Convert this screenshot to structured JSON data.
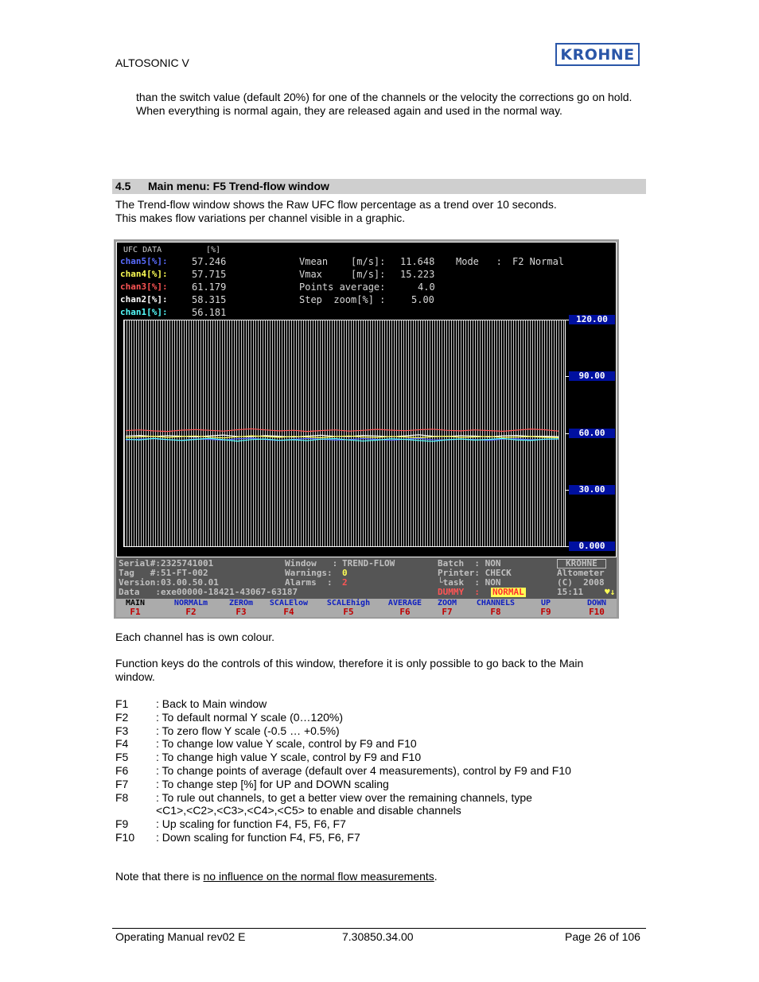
{
  "header": {
    "title": "ALTOSONIC V",
    "logo": "KROHNE"
  },
  "intro_text": "than the switch value (default 20%) for one of the channels or the velocity the corrections go on hold. When everything is normal again, they are released again and used in the normal way.",
  "section": {
    "number": "4.5",
    "title": "Main menu: F5 Trend-flow window"
  },
  "description": {
    "line1": "The Trend-flow window shows the Raw UFC flow percentage as a trend over 10 seconds.",
    "line2": "This makes flow variations per channel visible in a graphic."
  },
  "screen": {
    "ufc_header": "UFC DATA",
    "ufc_unit": "[%]",
    "channels": [
      {
        "label": "chan5[%]:",
        "value": "57.246",
        "color": "#5a6cff"
      },
      {
        "label": "chan4[%]:",
        "value": "57.715",
        "color": "#ffff55"
      },
      {
        "label": "chan3[%]:",
        "value": "61.179",
        "color": "#ff5555"
      },
      {
        "label": "chan2[%]:",
        "value": "58.315",
        "color": "#ffffff"
      },
      {
        "label": "chan1[%]:",
        "value": "56.181",
        "color": "#55ffff"
      }
    ],
    "info": {
      "vmean_label": "Vmean    [m/s]:",
      "vmean_value": "11.648",
      "vmax_label": "Vmax     [m/s]:",
      "vmax_value": "15.223",
      "points_label": "Points average:",
      "points_value": "4.0",
      "step_label": "Step  zoom[%] :",
      "step_value": "5.00",
      "mode_label": "Mode   :",
      "mode_value": "F2 Normal"
    },
    "y_ticks": [
      "120.00",
      "90.00",
      "60.00",
      "30.00",
      "0.000"
    ],
    "status": {
      "serial": "Serial#:2325741001",
      "tag": "Tag   #:51-FT-002",
      "version": "Version:03.00.50.01",
      "data": "Data   :exe00000-18421-43067-63187",
      "window_label": "Window   :",
      "window_value": "TREND-FLOW",
      "warnings_label": "Warnings:",
      "warnings_value": "0",
      "alarms_label": "Alarms  :",
      "alarms_value": "2",
      "batch": "Batch  : NON",
      "printer": "Printer: CHECK",
      "task": "└task  : NON",
      "dummy_label": "DUMMY  :",
      "dummy_value": "NORMAL",
      "brand": "KROHNE",
      "product": "Altometer",
      "copyright": "(C)  2008",
      "time": "15:11",
      "status_icons": "♥↓"
    },
    "function_keys": [
      {
        "label": "MAIN",
        "key": "F1"
      },
      {
        "label": "NORMALm",
        "key": "F2"
      },
      {
        "label": "ZEROm",
        "key": "F3"
      },
      {
        "label": "SCALElow",
        "key": "F4"
      },
      {
        "label": "SCALEhigh",
        "key": "F5"
      },
      {
        "label": "AVERAGE",
        "key": "F6"
      },
      {
        "label": "ZOOM",
        "key": "F7"
      },
      {
        "label": "CHANNELS",
        "key": "F8"
      },
      {
        "label": "UP",
        "key": "F9"
      },
      {
        "label": "DOWN",
        "key": "F10"
      }
    ]
  },
  "chart_data": {
    "type": "line",
    "title": "Trend-flow",
    "xlabel": "",
    "ylabel": "[%]",
    "ylim": [
      0,
      120
    ],
    "yticks": [
      0,
      30,
      60,
      90,
      120
    ],
    "grid": false,
    "series": [
      {
        "name": "chan3",
        "color": "#ff5555",
        "values": [
          61.5,
          61.8,
          61.3,
          61.0,
          61.7,
          62.0,
          61.6,
          61.2,
          61.9,
          62.4,
          61.8,
          61.3,
          61.6,
          61.0,
          61.5,
          61.8,
          61.2,
          61.6,
          62.1,
          61.7,
          61.4,
          61.9,
          62.2,
          61.6,
          61.3,
          61.8,
          61.5,
          61.1,
          61.7,
          62.3,
          61.9,
          61.2
        ]
      },
      {
        "name": "chan2",
        "color": "#ffffff",
        "values": [
          58.6,
          58.9,
          58.3,
          58.8,
          58.5,
          58.1,
          58.7,
          59.1,
          58.4,
          58.2,
          58.8,
          58.5,
          58.0,
          58.6,
          59.0,
          58.4,
          58.3,
          58.9,
          58.6,
          58.2,
          58.7,
          59.2,
          58.5,
          58.3,
          58.8,
          58.6,
          58.1,
          58.7,
          58.9,
          58.4,
          58.5,
          58.3
        ]
      },
      {
        "name": "chan4",
        "color": "#ffff55",
        "values": [
          57.8,
          58.2,
          58.5,
          57.9,
          58.3,
          58.6,
          58.0,
          57.6,
          58.2,
          58.7,
          58.3,
          57.9,
          58.4,
          58.1,
          57.7,
          58.3,
          58.6,
          58.0,
          57.8,
          58.4,
          58.1,
          57.7,
          58.2,
          58.5,
          57.9,
          58.1,
          58.4,
          57.8,
          58.0,
          58.3,
          57.9,
          57.7
        ]
      },
      {
        "name": "chan5",
        "color": "#5a6cff",
        "values": [
          56.5,
          56.9,
          57.2,
          56.6,
          56.3,
          57.0,
          56.8,
          56.4,
          57.1,
          57.4,
          56.7,
          56.2,
          56.8,
          57.3,
          56.9,
          56.4,
          56.7,
          57.2,
          56.8,
          56.3,
          56.9,
          57.3,
          56.6,
          56.5,
          57.0,
          56.7,
          56.2,
          56.9,
          57.1,
          56.6,
          56.8,
          57.0
        ]
      },
      {
        "name": "chan1",
        "color": "#55ffff",
        "values": [
          56.9,
          56.5,
          57.3,
          56.7,
          56.2,
          56.8,
          57.4,
          56.6,
          55.8,
          56.7,
          57.0,
          56.3,
          56.6,
          56.1,
          56.9,
          57.2,
          56.5,
          55.9,
          56.4,
          57.1,
          56.8,
          56.2,
          55.7,
          56.6,
          57.0,
          56.4,
          56.8,
          57.3,
          56.5,
          56.2,
          56.9,
          57.1
        ]
      }
    ]
  },
  "body": {
    "colour_note": "Each channel has is own colour.",
    "fkeys_note_line1": "Function keys do the controls of this window, therefore it is only possible to go back to the Main",
    "fkeys_note_line2": "window.",
    "key_list": [
      {
        "key": "F1",
        "text": ": Back to Main window"
      },
      {
        "key": "F2",
        "text": ": To default normal Y scale (0…120%)"
      },
      {
        "key": "F3",
        "text": ": To zero flow Y scale (-0.5 … +0.5%)"
      },
      {
        "key": "F4",
        "text": ": To change low value Y scale, control by F9 and F10"
      },
      {
        "key": "F5",
        "text": ": To change high value Y scale, control by F9 and F10"
      },
      {
        "key": "F6",
        "text": ": To change points of average (default over 4 measurements), control by F9 and F10"
      },
      {
        "key": "F7",
        "text": ": To change step [%] for UP and DOWN scaling"
      },
      {
        "key": "F8",
        "text": ": To rule out channels, to get a better view over the remaining channels, type"
      },
      {
        "key": "",
        "text": "  <C1>,<C2>,<C3>,<C4>,<C5> to enable and disable channels"
      },
      {
        "key": "F9",
        "text": ": Up scaling for function F4, F5, F6, F7"
      },
      {
        "key": "F10",
        "text": ": Down scaling for function F4, F5, F6, F7"
      }
    ],
    "note_prefix": "Note that there is ",
    "note_underlined": "no influence on the normal flow measurements",
    "note_suffix": "."
  },
  "footer": {
    "left": "Operating Manual  rev02 E",
    "center": "7.30850.34.00",
    "right": "Page 26 of 106"
  }
}
